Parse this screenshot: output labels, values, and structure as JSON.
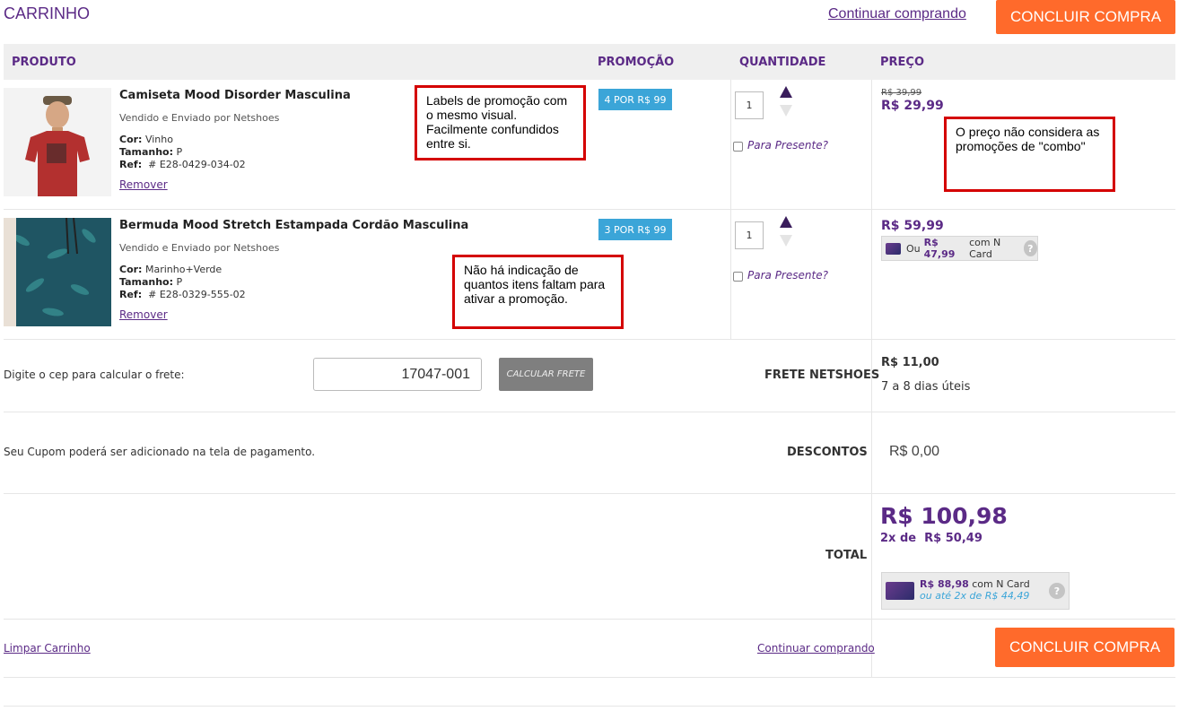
{
  "page": {
    "title": "CARRINHO",
    "continue_link": "Continuar comprando",
    "checkout_button": "CONCLUIR COMPRA"
  },
  "table_header": {
    "product": "PRODUTO",
    "promo": "PROMOÇÃO",
    "quantity": "QUANTIDADE",
    "price": "PREÇO"
  },
  "items": [
    {
      "name": "Camiseta Mood Disorder Masculina",
      "seller": "Vendido e Enviado por Netshoes",
      "color_label": "Cor:",
      "color": "Vinho",
      "size_label": "Tamanho:",
      "size": "P",
      "ref_label": "Ref:",
      "ref": "# E28-0429-034-02",
      "remove": "Remover",
      "promo": "4 POR R$ 99",
      "qty": "1",
      "gift": "Para Presente?",
      "old_price": "R$ 39,99",
      "price": "R$ 29,99"
    },
    {
      "name": "Bermuda Mood Stretch Estampada Cordão Masculina",
      "seller": "Vendido e Enviado por Netshoes",
      "color_label": "Cor:",
      "color": "Marinho+Verde",
      "size_label": "Tamanho:",
      "size": "P",
      "ref_label": "Ref:",
      "ref": "# E28-0329-555-02",
      "remove": "Remover",
      "promo": "3 POR R$ 99",
      "qty": "1",
      "gift": "Para Presente?",
      "price": "R$ 59,99",
      "ncard_prefix": "Ou",
      "ncard_price": "R$ 47,99",
      "ncard_suffix": "com N Card"
    }
  ],
  "annotations": {
    "promo_labels": "Labels de promoção com o mesmo visual. Facilmente confundidos entre si.",
    "price_combo": "O preço não considera as promoções de \"combo\"",
    "items_missing": "Não há indicação de quantos itens faltam para ativar a promoção."
  },
  "shipping": {
    "prompt": "Digite o cep para calcular o frete:",
    "cep": "17047-001",
    "calc_button": "CALCULAR FRETE",
    "label": "FRETE NETSHOES",
    "price": "R$ 11,00",
    "eta": "7 a 8 dias úteis"
  },
  "coupon": {
    "note": "Seu Cupom poderá ser adicionado na tela de pagamento.",
    "label": "DESCONTOS",
    "value": "R$ 0,00"
  },
  "total": {
    "label": "TOTAL",
    "value": "R$ 100,98",
    "installments_prefix": "2x de",
    "installments_value": "R$ 50,49",
    "ncard_price": "R$ 88,98",
    "ncard_suffix": "com N Card",
    "ncard_installments": "ou até 2x de R$ 44,49"
  },
  "footer": {
    "clear_cart": "Limpar Carrinho",
    "continue_link": "Continuar comprando",
    "checkout_button": "CONCLUIR COMPRA"
  },
  "colors": {
    "accent": "#5b2a86",
    "orange": "#ff6a2b",
    "promo_badge": "#3ba5d8",
    "annotation_border": "#d40000"
  }
}
